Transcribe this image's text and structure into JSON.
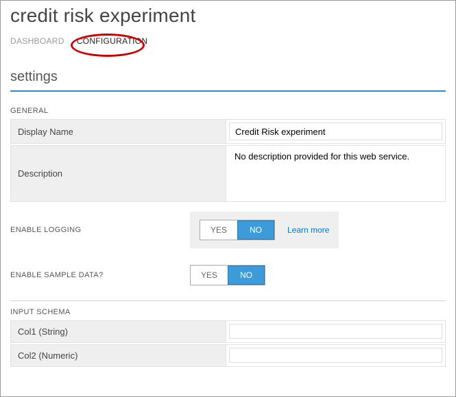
{
  "header": {
    "title": "credit risk experiment",
    "tabs": {
      "dashboard": "DASHBOARD",
      "configuration": "CONFIGURATION"
    },
    "active_tab": "configuration"
  },
  "settings": {
    "heading": "settings",
    "general": {
      "label": "GENERAL",
      "display_name": {
        "label": "Display Name",
        "value": "Credit Risk experiment"
      },
      "description": {
        "label": "Description",
        "value": "No description provided for this web service."
      }
    },
    "enable_logging": {
      "label": "ENABLE LOGGING",
      "yes": "YES",
      "no": "NO",
      "selected": "NO",
      "learn_more": "Learn more"
    },
    "enable_sample_data": {
      "label": "ENABLE SAMPLE DATA?",
      "yes": "YES",
      "no": "NO",
      "selected": "NO"
    },
    "input_schema": {
      "label": "INPUT SCHEMA",
      "rows": [
        {
          "name": "Col1 (String)",
          "value": ""
        },
        {
          "name": "Col2 (Numeric)",
          "value": ""
        }
      ]
    }
  }
}
